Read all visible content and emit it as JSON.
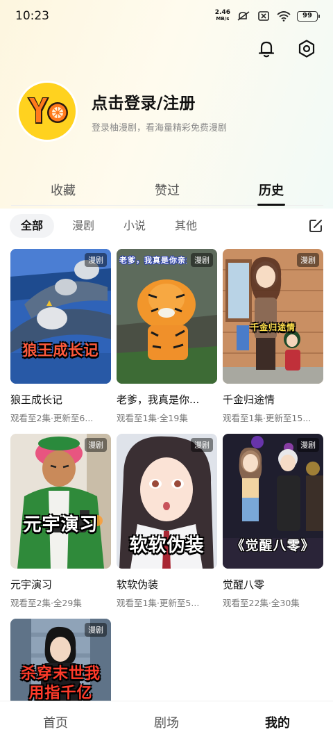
{
  "status": {
    "time": "10:23",
    "net_speed_value": "2.46",
    "net_speed_unit": "MB/s",
    "battery": "99"
  },
  "header": {
    "icons": [
      "bell-icon",
      "settings-icon"
    ]
  },
  "profile": {
    "avatar_icon": "yo-logo",
    "title": "点击登录/注册",
    "subtitle": "登录柚漫剧，看海量精彩免费漫剧"
  },
  "tabs": [
    {
      "label": "收藏",
      "active": false
    },
    {
      "label": "赞过",
      "active": false
    },
    {
      "label": "历史",
      "active": true
    }
  ],
  "filters": [
    {
      "label": "全部",
      "active": true
    },
    {
      "label": "漫剧",
      "active": false
    },
    {
      "label": "小说",
      "active": false
    },
    {
      "label": "其他",
      "active": false
    }
  ],
  "items": [
    {
      "badge": "漫剧",
      "cover_text": "狼王成长记",
      "title": "狼王成长记",
      "meta": "观看至2集·更新至6..."
    },
    {
      "badge": "漫剧",
      "cover_text": "老爹，我真是你亲生",
      "title": "老爹，我真是你...",
      "meta": "观看至1集·全19集"
    },
    {
      "badge": "漫剧",
      "cover_text": "千金归途情",
      "title": "千金归途情",
      "meta": "观看至1集·更新至15..."
    },
    {
      "badge": "漫剧",
      "cover_text": "元宇演习",
      "title": "元宇演习",
      "meta": "观看至2集·全29集"
    },
    {
      "badge": "漫剧",
      "cover_text": "软软伪装",
      "title": "软软伪装",
      "meta": "观看至1集·更新至5..."
    },
    {
      "badge": "漫剧",
      "cover_text": "《觉醒八零》",
      "title": "觉醒八零",
      "meta": "观看至22集·全30集"
    },
    {
      "badge": "漫剧",
      "cover_text": "杀穿末世我用指千亿",
      "title": "",
      "meta": ""
    }
  ],
  "nav": [
    {
      "label": "首页",
      "active": false
    },
    {
      "label": "剧场",
      "active": false
    },
    {
      "label": "我的",
      "active": true
    }
  ]
}
